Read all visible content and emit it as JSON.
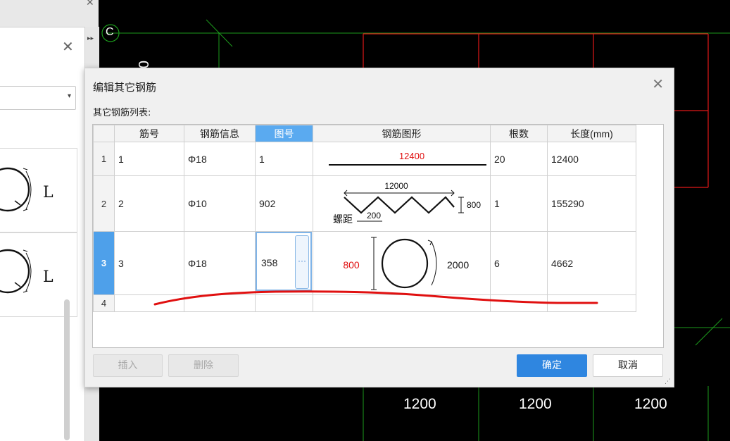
{
  "background": {
    "cad_marker": "C",
    "cad_zero": "0",
    "dimensions": [
      "1200",
      "1200",
      "1200"
    ]
  },
  "side_panel": {
    "card_labels": [
      "L",
      "L"
    ]
  },
  "dialog": {
    "title": "编辑其它钢筋",
    "list_label": "其它钢筋列表:",
    "columns": [
      "筋号",
      "钢筋信息",
      "图号",
      "钢筋图形",
      "根数",
      "长度(mm)"
    ],
    "selected_column": "图号",
    "rows": [
      {
        "index": "1",
        "bar_no": "1",
        "bar_info": "Φ18",
        "shape_no": "1",
        "count": "20",
        "length": "12400",
        "shape": {
          "label": "12400"
        }
      },
      {
        "index": "2",
        "bar_no": "2",
        "bar_info": "Φ10",
        "shape_no": "902",
        "count": "1",
        "length": "155290",
        "shape": {
          "top": "12000",
          "height": "800",
          "pitch_label": "螺距",
          "pitch": "200"
        }
      },
      {
        "index": "3",
        "bar_no": "3",
        "bar_info": "Φ18",
        "shape_no": "358",
        "count": "6",
        "length": "4662",
        "shape": {
          "diameter": "800",
          "length": "2000"
        }
      },
      {
        "index": "4",
        "bar_no": "",
        "bar_info": "",
        "shape_no": "",
        "count": "",
        "length": ""
      }
    ],
    "selected_row": "3",
    "edit_button_glyph": "···",
    "buttons": {
      "insert": "插入",
      "delete": "删除",
      "ok": "确定",
      "cancel": "取消"
    },
    "colors": {
      "accent": "#2f86e0",
      "annotation": "#e01010"
    }
  }
}
